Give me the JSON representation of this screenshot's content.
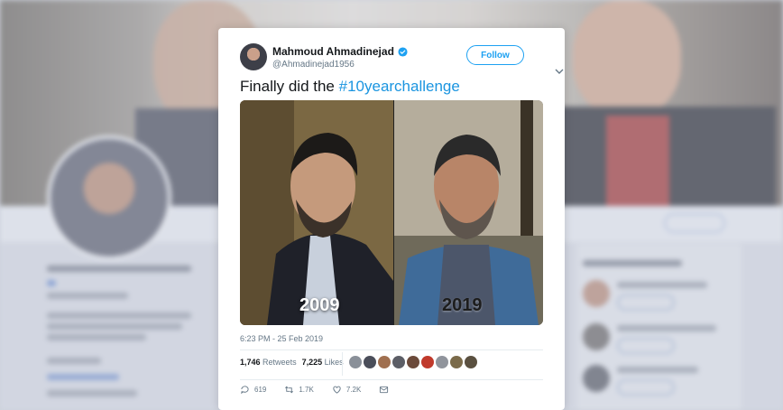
{
  "background": {
    "profile_name": "Mahmoud Ahmadinejad",
    "who_to_follow": "Who to follow",
    "follow_label": "Follow"
  },
  "tweet": {
    "author": {
      "name": "Mahmoud Ahmadinejad",
      "handle": "@Ahmadinejad1956",
      "verified": true
    },
    "follow_label": "Follow",
    "text_prefix": "Finally did the ",
    "hashtag": "#10yearchallenge",
    "photo": {
      "left_year": "2009",
      "right_year": "2019"
    },
    "timestamp": "6:23 PM - 25 Feb 2019",
    "stats": {
      "retweets_count": "1,746",
      "retweets_label": "Retweets",
      "likes_count": "7,225",
      "likes_label": "Likes"
    },
    "likers": [
      "#8a9099",
      "#4a4e5a",
      "#a07050",
      "#5c5e66",
      "#6b4a3a",
      "#c0392b",
      "#90949c",
      "#7a6a4a",
      "#5a5040"
    ],
    "actions": {
      "replies": "619",
      "retweets": "1.7K",
      "likes": "7.2K"
    },
    "colors": {
      "accent": "#1da1f2",
      "hashtag": "#1b95e0",
      "verified": "#1da1f2"
    }
  }
}
